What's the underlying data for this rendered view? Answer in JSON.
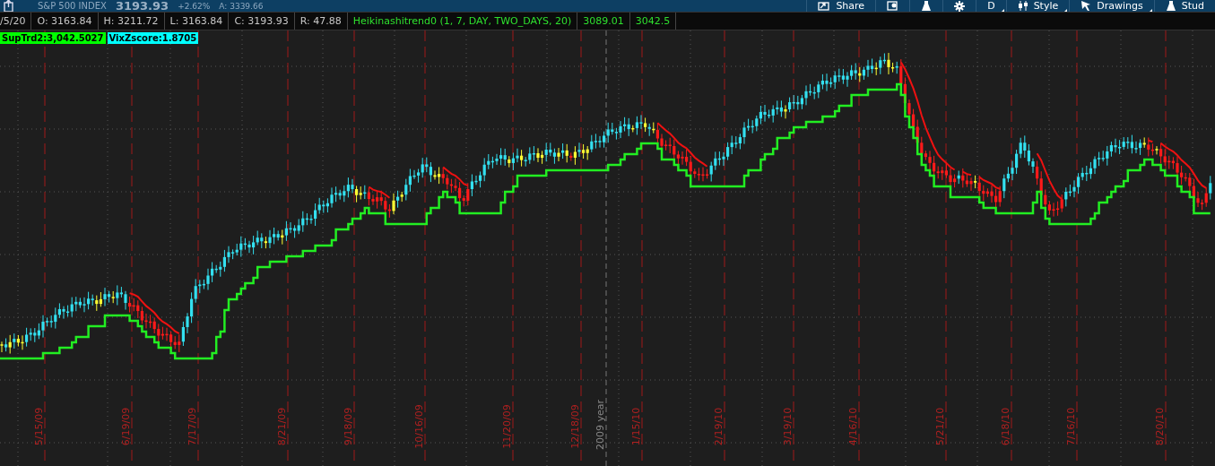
{
  "header": {
    "symbol": "S&P 500 INDEX",
    "last": "3193.93",
    "change": "+2.62%",
    "ask": "A: 3339.66",
    "toolbar": [
      {
        "label": "Share",
        "menu": false
      },
      {
        "menu": false
      },
      {
        "menu": false
      },
      {
        "menu": false
      },
      {
        "label": "D",
        "menu": true
      },
      {
        "label": "Style",
        "menu": true
      },
      {
        "label": "Drawings",
        "menu": true
      },
      {
        "label": "Stud",
        "menu": false
      }
    ]
  },
  "quote_bar": {
    "cells": [
      "/5/20",
      "O: 3163.84",
      "H: 3211.72",
      "L: 3163.84",
      "C: 3193.93",
      "R: 47.88"
    ],
    "study": {
      "label": "Heikinashitrend0 (1, 7, DAY, TWO_DAYS, 20)",
      "values": [
        "3089.01",
        "3042.5"
      ]
    }
  },
  "badges": [
    {
      "text": "SupTrd2:3,042.5027",
      "color": "#00ff00"
    },
    {
      "text": "VixZscore:1.8705",
      "color": "#00ffff"
    }
  ],
  "x_axis": {
    "labels": [
      {
        "text": "5/15/09",
        "kind": "date"
      },
      {
        "text": "6/19/09",
        "kind": "date"
      },
      {
        "text": "7/17/09",
        "kind": "date"
      },
      {
        "text": "8/21/09",
        "kind": "date"
      },
      {
        "text": "9/18/09",
        "kind": "date"
      },
      {
        "text": "10/16/09",
        "kind": "date"
      },
      {
        "text": "11/20/09",
        "kind": "date"
      },
      {
        "text": "12/18/09",
        "kind": "date"
      },
      {
        "text": "2009 year",
        "kind": "year"
      },
      {
        "text": "1/15/10",
        "kind": "date"
      },
      {
        "text": "2/19/10",
        "kind": "date"
      },
      {
        "text": "3/19/10",
        "kind": "date"
      },
      {
        "text": "4/16/10",
        "kind": "date"
      },
      {
        "text": "5/21/10",
        "kind": "date"
      },
      {
        "text": "6/18/10",
        "kind": "date"
      },
      {
        "text": "7/16/10",
        "kind": "date"
      },
      {
        "text": "8/20/10",
        "kind": "date"
      }
    ]
  }
}
